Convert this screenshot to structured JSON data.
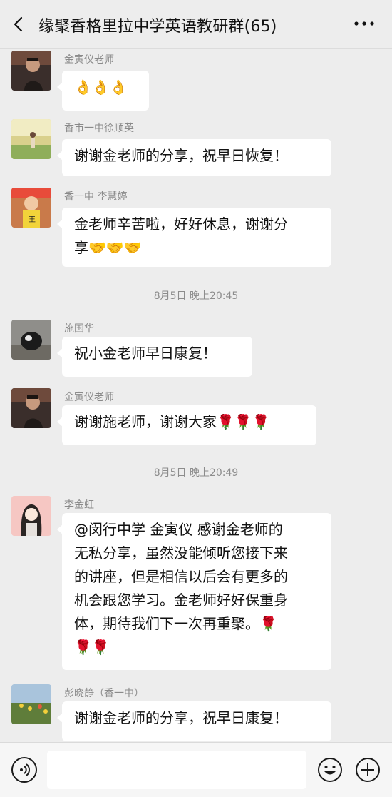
{
  "header": {
    "title": "缘聚香格里拉中学英语教研群(65)",
    "back_icon": "chevron-left-icon",
    "more_icon": "more-dots-icon"
  },
  "messages": [
    {
      "sender": "金寅仪老师",
      "lines": [
        "👌👌👌"
      ],
      "avatar": "portrait-man"
    },
    {
      "sender": "香市一中徐顺英",
      "lines": [
        "谢谢金老师的分享，祝早日恢复！"
      ],
      "avatar": "landscape-person"
    },
    {
      "sender": "香一中  李慧婷",
      "lines": [
        "金老师辛苦啦，好好休息，谢谢分",
        "享🤝🤝🤝"
      ],
      "avatar": "child-photo"
    },
    {
      "timestamp": "8月5日 晚上20:45"
    },
    {
      "sender": "施国华",
      "lines": [
        "祝小金老师早日康复！"
      ],
      "avatar": "dog-photo"
    },
    {
      "sender": "金寅仪老师",
      "lines": [
        "谢谢施老师，谢谢大家🌹🌹🌹"
      ],
      "avatar": "portrait-man"
    },
    {
      "timestamp": "8月5日 晚上20:49"
    },
    {
      "sender": "李金虹",
      "lines": [
        "@闵行中学 金寅仪  感谢金老师的",
        "无私分享，虽然没能倾听您接下来",
        "的讲座，但是相信以后会有更多的",
        "机会跟您学习。金老师好好保重身",
        "体，期待我们下一次再重聚。🌹",
        "🌹🌹"
      ],
      "avatar": "cartoon-girl"
    },
    {
      "sender": "彭晓静（香一中）",
      "lines": [
        "谢谢金老师的分享，祝早日康复！"
      ],
      "avatar": "flower-field"
    }
  ],
  "input_bar": {
    "voice_icon": "voice-icon",
    "emoji_icon": "emoji-icon",
    "plus_icon": "plus-icon",
    "draft": ""
  },
  "colors": {
    "background": "#ededed",
    "bubble": "#ffffff",
    "sender_text": "#8a8a8a",
    "timestamp_text": "#8c8c8c"
  }
}
